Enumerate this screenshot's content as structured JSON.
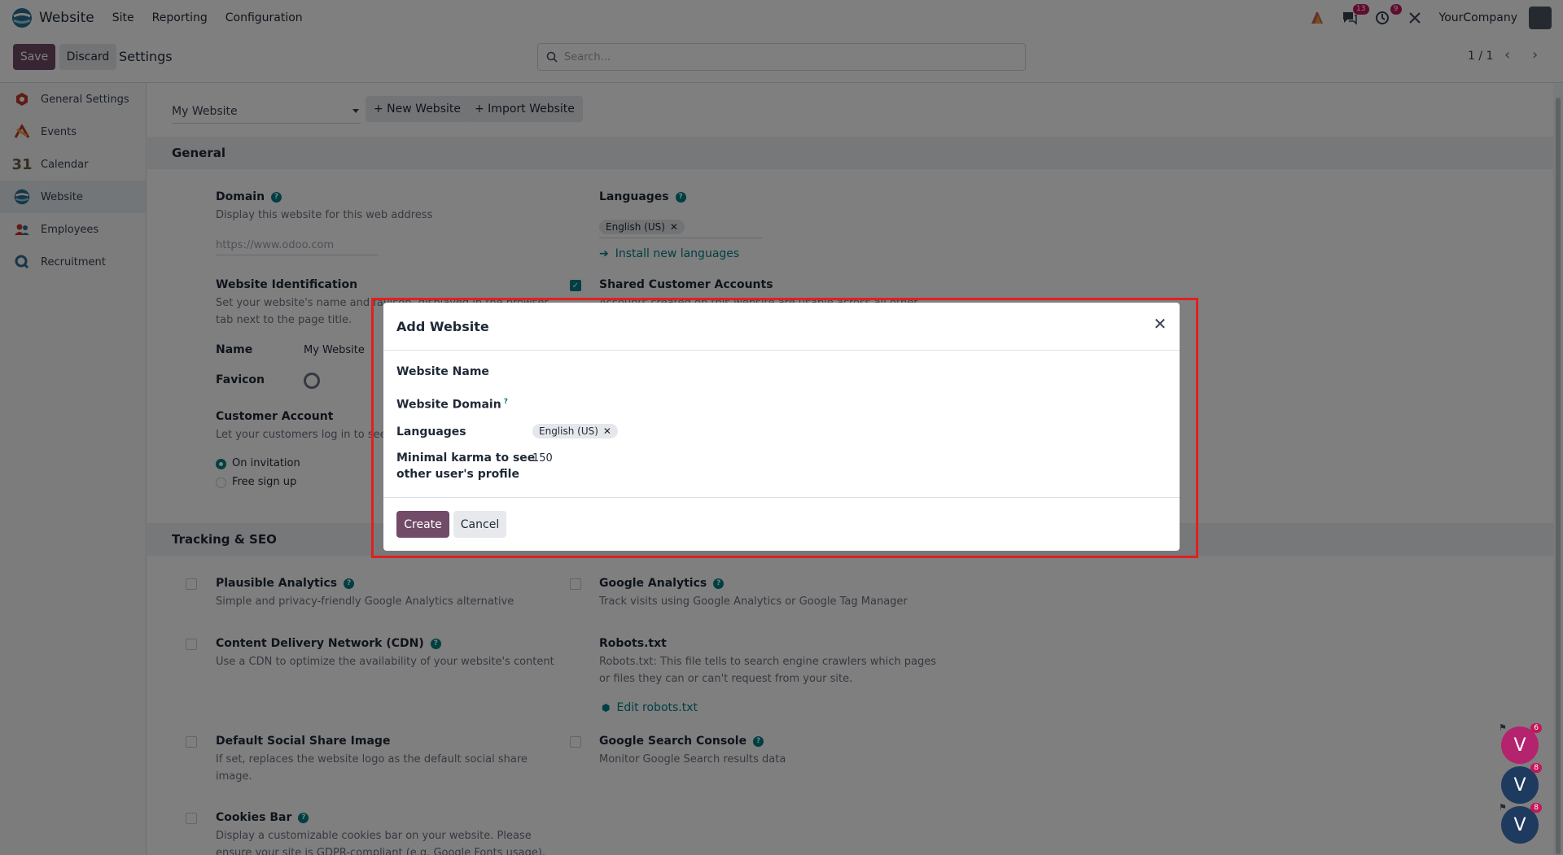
{
  "navbar": {
    "app_name": "Website",
    "menu": [
      "Site",
      "Reporting",
      "Configuration"
    ],
    "messages_count": "13",
    "activities_count": "9",
    "company": "YourCompany"
  },
  "control_panel": {
    "save_label": "Save",
    "discard_label": "Discard",
    "title": "Settings",
    "search_placeholder": "Search...",
    "pager": "1 / 1"
  },
  "sidebar": {
    "items": [
      {
        "label": "General Settings"
      },
      {
        "label": "Events"
      },
      {
        "label": "Calendar"
      },
      {
        "label": "Website"
      },
      {
        "label": "Employees"
      },
      {
        "label": "Recruitment"
      }
    ]
  },
  "main": {
    "website_select": "My Website",
    "new_website_label": "+ New Website",
    "import_website_label": "+ Import Website",
    "general": {
      "heading": "General",
      "domain_title": "Domain",
      "domain_desc": "Display this website for this web address",
      "domain_placeholder": "https://www.odoo.com",
      "languages_title": "Languages",
      "languages_tag": "English (US)",
      "install_languages": "Install new languages",
      "identification_title": "Website Identification",
      "identification_desc_1": "Set your website's name and favicon, displayed in the browser",
      "identification_desc_2": "tab next to the page title.",
      "name_label": "Name",
      "name_value": "My Website",
      "favicon_label": "Favicon",
      "shared_accounts_title": "Shared Customer Accounts",
      "shared_accounts_desc": "Accounts created on this website are usable across all other",
      "customer_account_title": "Customer Account",
      "customer_account_desc": "Let your customers log in to see their documents",
      "on_invitation": "On invitation",
      "free_signup": "Free sign up"
    },
    "tracking": {
      "heading": "Tracking & SEO",
      "plausible_title": "Plausible Analytics",
      "plausible_desc": "Simple and privacy-friendly Google Analytics alternative",
      "ga_title": "Google Analytics",
      "ga_desc": "Track visits using Google Analytics or Google Tag Manager",
      "cdn_title": "Content Delivery Network (CDN)",
      "cdn_desc": "Use a CDN to optimize the availability of your website's content",
      "robots_title": "Robots.txt",
      "robots_desc_1": "Robots.txt: This file tells to search engine crawlers which pages",
      "robots_desc_2": "or files they can or can't request from your site.",
      "edit_robots": "Edit robots.txt",
      "social_title": "Default Social Share Image",
      "social_desc_1": "If set, replaces the website logo as the default social share",
      "social_desc_2": "image.",
      "gsc_title": "Google Search Console",
      "gsc_desc": "Monitor Google Search results data",
      "cookies_title": "Cookies Bar",
      "cookies_desc_1": "Display a customizable cookies bar on your website. Please",
      "cookies_desc_2": "ensure your site is GDPR-compliant (e.g. Google Fonts usage)."
    }
  },
  "modal": {
    "title": "Add Website",
    "website_name_label": "Website Name",
    "website_domain_label": "Website Domain",
    "domain_help": "?",
    "languages_label": "Languages",
    "languages_tag": "English (US)",
    "karma_label_1": "Minimal karma to see",
    "karma_label_2": "other user's profile",
    "karma_value": "150",
    "create_label": "Create",
    "cancel_label": "Cancel"
  },
  "chat": {
    "bubbles": [
      {
        "letter": "V",
        "count": "6",
        "color": "#b3236e"
      },
      {
        "letter": "V",
        "count": "8",
        "color": "#1e3a5f"
      },
      {
        "letter": "V",
        "count": "8",
        "color": "#1e3a5f"
      }
    ]
  },
  "colors": {
    "primary": "#714b67",
    "accent": "#017e84",
    "highlight": "#e02020"
  }
}
